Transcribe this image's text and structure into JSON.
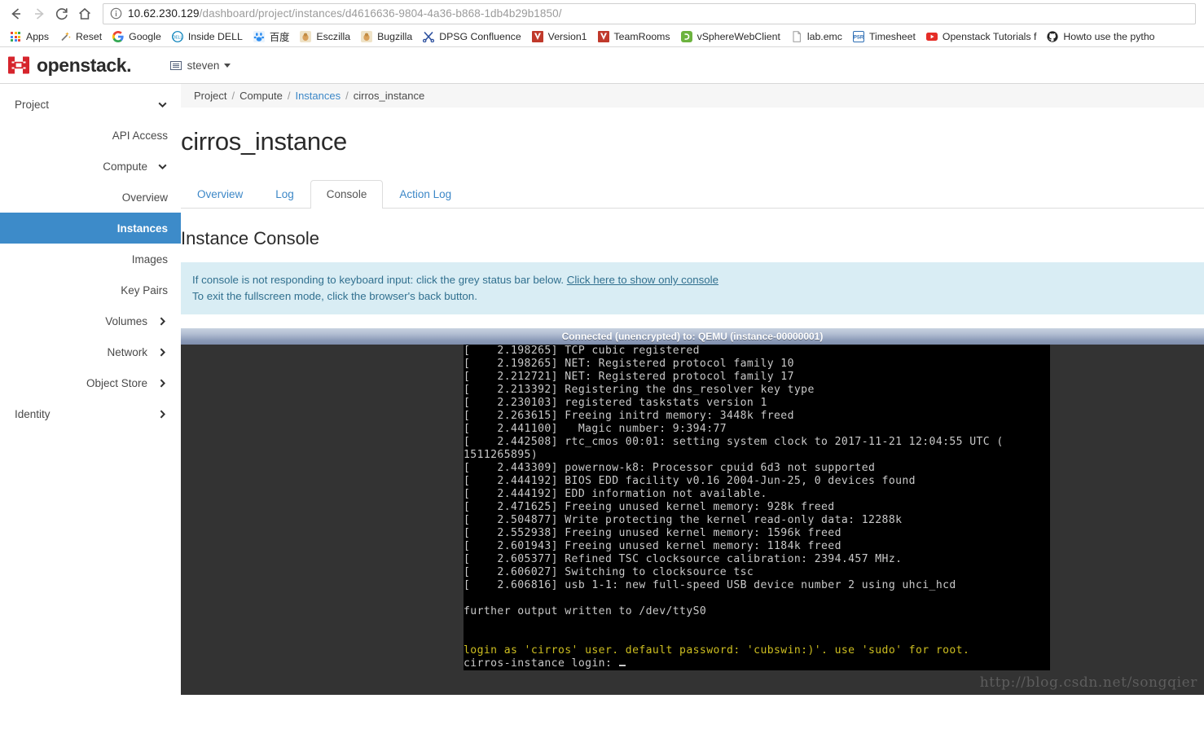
{
  "browser": {
    "nav": {
      "back_icon": "arrow-left-icon",
      "forward_icon": "arrow-right-icon",
      "reload_icon": "reload-icon",
      "home_icon": "home-icon"
    },
    "url": {
      "info_icon": "page-info-icon",
      "host": "10.62.230.129",
      "path": "/dashboard/project/instances/d4616636-9804-4a36-b868-1db4b29b1850/"
    },
    "bookmarks": [
      {
        "label": "Apps",
        "icon": "apps-grid-icon",
        "color": "#4285f4"
      },
      {
        "label": "Reset",
        "icon": "magic-wand-icon",
        "color": "#8a8a8a"
      },
      {
        "label": "Google",
        "icon": "google-g-icon",
        "color": "#4285f4"
      },
      {
        "label": "Inside DELL",
        "icon": "dell-circle-icon",
        "color": "#007db8"
      },
      {
        "label": "百度",
        "icon": "baidu-paw-icon",
        "color": "#2b8cf0"
      },
      {
        "label": "Esczilla",
        "icon": "bugzilla-icon",
        "color": "#d8a05a"
      },
      {
        "label": "Bugzilla",
        "icon": "bugzilla-icon",
        "color": "#d8a05a"
      },
      {
        "label": "DPSG Confluence",
        "icon": "scissors-icon",
        "color": "#2b4f9e"
      },
      {
        "label": "Version1",
        "icon": "version1-icon",
        "color": "#c0392b"
      },
      {
        "label": "TeamRooms",
        "icon": "version1-icon",
        "color": "#c0392b"
      },
      {
        "label": "vSphereWebClient",
        "icon": "vsphere-icon",
        "color": "#6cb33f"
      },
      {
        "label": "lab.emc",
        "icon": "document-icon",
        "color": "#9a9a9a"
      },
      {
        "label": "Timesheet",
        "icon": "timesheet-icon",
        "color": "#2f6fb5"
      },
      {
        "label": "Openstack Tutorials f",
        "icon": "youtube-icon",
        "color": "#e52d27"
      },
      {
        "label": "Howto use the pytho",
        "icon": "github-icon",
        "color": "#222222"
      }
    ]
  },
  "header": {
    "brand": "openstack",
    "brand_dot": ".",
    "logo_icon": "openstack-mark-icon",
    "user": {
      "name": "steven",
      "icon": "user-card-icon",
      "caret_icon": "caret-down-icon"
    }
  },
  "sidebar": {
    "items": [
      {
        "label": "Project",
        "level": 0,
        "chevron": "chevron-down-icon",
        "active": false,
        "name": "sidebar-item-project"
      },
      {
        "label": "API Access",
        "level": 2,
        "chevron": "",
        "active": false,
        "name": "sidebar-item-api-access"
      },
      {
        "label": "Compute",
        "level": 1,
        "chevron": "chevron-down-icon",
        "active": false,
        "name": "sidebar-item-compute"
      },
      {
        "label": "Overview",
        "level": 2,
        "chevron": "",
        "active": false,
        "name": "sidebar-item-overview"
      },
      {
        "label": "Instances",
        "level": 2,
        "chevron": "",
        "active": true,
        "name": "sidebar-item-instances"
      },
      {
        "label": "Images",
        "level": 2,
        "chevron": "",
        "active": false,
        "name": "sidebar-item-images"
      },
      {
        "label": "Key Pairs",
        "level": 2,
        "chevron": "",
        "active": false,
        "name": "sidebar-item-key-pairs"
      },
      {
        "label": "Volumes",
        "level": 1,
        "chevron": "chevron-right-icon",
        "active": false,
        "name": "sidebar-item-volumes"
      },
      {
        "label": "Network",
        "level": 1,
        "chevron": "chevron-right-icon",
        "active": false,
        "name": "sidebar-item-network"
      },
      {
        "label": "Object Store",
        "level": 1,
        "chevron": "chevron-right-icon",
        "active": false,
        "name": "sidebar-item-object-store"
      },
      {
        "label": "Identity",
        "level": 0,
        "chevron": "chevron-right-icon",
        "active": false,
        "name": "sidebar-item-identity"
      }
    ]
  },
  "main": {
    "breadcrumb": [
      {
        "label": "Project",
        "link": false
      },
      {
        "label": "Compute",
        "link": false
      },
      {
        "label": "Instances",
        "link": true
      },
      {
        "label": "cirros_instance",
        "link": false
      }
    ],
    "page_title": "cirros_instance",
    "tabs": [
      {
        "label": "Overview",
        "active": false
      },
      {
        "label": "Log",
        "active": false
      },
      {
        "label": "Console",
        "active": true
      },
      {
        "label": "Action Log",
        "active": false
      }
    ],
    "section_title": "Instance Console",
    "alert": {
      "line1_before": "If console is not responding to keyboard input: click the grey status bar below. ",
      "link_text": "Click here to show only console",
      "line2": "To exit the fullscreen mode, click the browser's back button."
    }
  },
  "console": {
    "status_bar": "Connected (unencrypted) to: QEMU (instance-00000001)",
    "lines": [
      {
        "text": "[    2.198265] TCP cubic registered",
        "color": "gray"
      },
      {
        "text": "[    2.198265] NET: Registered protocol family 10",
        "color": "gray"
      },
      {
        "text": "[    2.212721] NET: Registered protocol family 17",
        "color": "gray"
      },
      {
        "text": "[    2.213392] Registering the dns_resolver key type",
        "color": "gray"
      },
      {
        "text": "[    2.230103] registered taskstats version 1",
        "color": "gray"
      },
      {
        "text": "[    2.263615] Freeing initrd memory: 3448k freed",
        "color": "gray"
      },
      {
        "text": "[    2.441100]   Magic number: 9:394:77",
        "color": "gray"
      },
      {
        "text": "[    2.442508] rtc_cmos 00:01: setting system clock to 2017-11-21 12:04:55 UTC (",
        "color": "gray"
      },
      {
        "text": "1511265895)",
        "color": "gray"
      },
      {
        "text": "[    2.443309] powernow-k8: Processor cpuid 6d3 not supported",
        "color": "gray"
      },
      {
        "text": "[    2.444192] BIOS EDD facility v0.16 2004-Jun-25, 0 devices found",
        "color": "gray"
      },
      {
        "text": "[    2.444192] EDD information not available.",
        "color": "gray"
      },
      {
        "text": "[    2.471625] Freeing unused kernel memory: 928k freed",
        "color": "gray"
      },
      {
        "text": "[    2.504877] Write protecting the kernel read-only data: 12288k",
        "color": "gray"
      },
      {
        "text": "[    2.552938] Freeing unused kernel memory: 1596k freed",
        "color": "gray"
      },
      {
        "text": "[    2.601943] Freeing unused kernel memory: 1184k freed",
        "color": "gray"
      },
      {
        "text": "[    2.605377] Refined TSC clocksource calibration: 2394.457 MHz.",
        "color": "gray"
      },
      {
        "text": "[    2.606027] Switching to clocksource tsc",
        "color": "gray"
      },
      {
        "text": "[    2.606816] usb 1-1: new full-speed USB device number 2 using uhci_hcd",
        "color": "gray"
      },
      {
        "text": "",
        "color": "gray"
      },
      {
        "text": "further output written to /dev/ttyS0",
        "color": "gray"
      },
      {
        "text": "",
        "color": "gray"
      },
      {
        "text": "",
        "color": "gray"
      },
      {
        "text": "login as 'cirros' user. default password: 'cubswin:)'. use 'sudo' for root.",
        "color": "yellow"
      },
      {
        "text": "cirros-instance login: ",
        "color": "gray",
        "cursor": true
      }
    ]
  },
  "watermark": "http://blog.csdn.net/songqier"
}
